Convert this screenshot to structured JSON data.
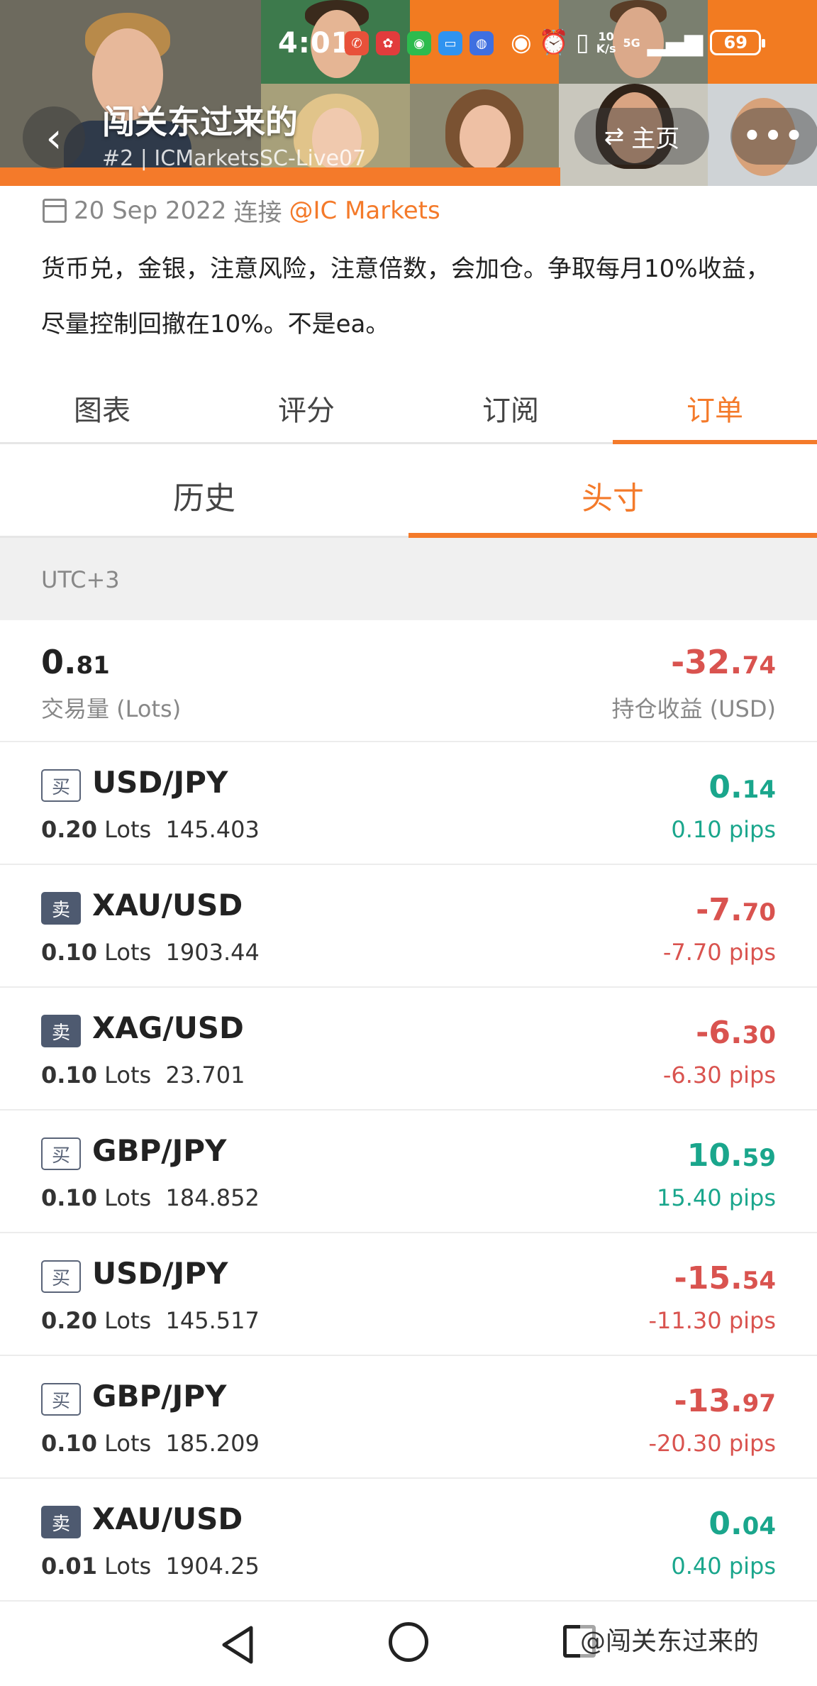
{
  "status_bar": {
    "time": "4:01",
    "network_speed_value": "10",
    "network_speed_unit": "K/s",
    "signal": "5G",
    "battery": "69"
  },
  "header": {
    "name": "闯关东过来的",
    "account": "#2 | ICMarketsSC-Live07",
    "home_label": "主页",
    "more_label": "•••"
  },
  "info": {
    "date": "20 Sep 2022",
    "connect_label": "连接",
    "broker": "@IC Markets",
    "description": "货币兑，金银，注意风险，注意倍数，会加仓。争取每月10%收益，尽量控制回撤在10%。不是ea。"
  },
  "tabs": [
    "图表",
    "评分",
    "订阅",
    "订单"
  ],
  "active_tab": "订单",
  "subtabs": [
    "历史",
    "头寸"
  ],
  "active_subtab": "头寸",
  "timezone": "UTC+3",
  "summary": {
    "lots_whole": "0.",
    "lots_frac": "81",
    "lots_label": "交易量 (Lots)",
    "pnl_whole": "-32.",
    "pnl_frac": "74",
    "pnl_label": "持仓收益 (USD)"
  },
  "positions": [
    {
      "side": "买",
      "type": "buy",
      "symbol": "USD/JPY",
      "lots": "0.20",
      "lots_unit": "Lots",
      "price": "145.403",
      "pnl_whole": "0.",
      "pnl_frac": "14",
      "pips": "0.10 pips",
      "tone": "green"
    },
    {
      "side": "卖",
      "type": "sell",
      "symbol": "XAU/USD",
      "lots": "0.10",
      "lots_unit": "Lots",
      "price": "1903.44",
      "pnl_whole": "-7.",
      "pnl_frac": "70",
      "pips": "-7.70 pips",
      "tone": "red"
    },
    {
      "side": "卖",
      "type": "sell",
      "symbol": "XAG/USD",
      "lots": "0.10",
      "lots_unit": "Lots",
      "price": "23.701",
      "pnl_whole": "-6.",
      "pnl_frac": "30",
      "pips": "-6.30 pips",
      "tone": "red"
    },
    {
      "side": "买",
      "type": "buy",
      "symbol": "GBP/JPY",
      "lots": "0.10",
      "lots_unit": "Lots",
      "price": "184.852",
      "pnl_whole": "10.",
      "pnl_frac": "59",
      "pips": "15.40 pips",
      "tone": "green"
    },
    {
      "side": "买",
      "type": "buy",
      "symbol": "USD/JPY",
      "lots": "0.20",
      "lots_unit": "Lots",
      "price": "145.517",
      "pnl_whole": "-15.",
      "pnl_frac": "54",
      "pips": "-11.30 pips",
      "tone": "red"
    },
    {
      "side": "买",
      "type": "buy",
      "symbol": "GBP/JPY",
      "lots": "0.10",
      "lots_unit": "Lots",
      "price": "185.209",
      "pnl_whole": "-13.",
      "pnl_frac": "97",
      "pips": "-20.30 pips",
      "tone": "red"
    },
    {
      "side": "卖",
      "type": "sell",
      "symbol": "XAU/USD",
      "lots": "0.01",
      "lots_unit": "Lots",
      "price": "1904.25",
      "pnl_whole": "0.",
      "pnl_frac": "04",
      "pips": "0.40 pips",
      "tone": "green"
    }
  ],
  "watermark": "@闯关东过来的",
  "colors": {
    "accent": "#f47a2a",
    "profit": "#1aa68c",
    "loss": "#d9534f",
    "badge": "#4e5a70"
  }
}
